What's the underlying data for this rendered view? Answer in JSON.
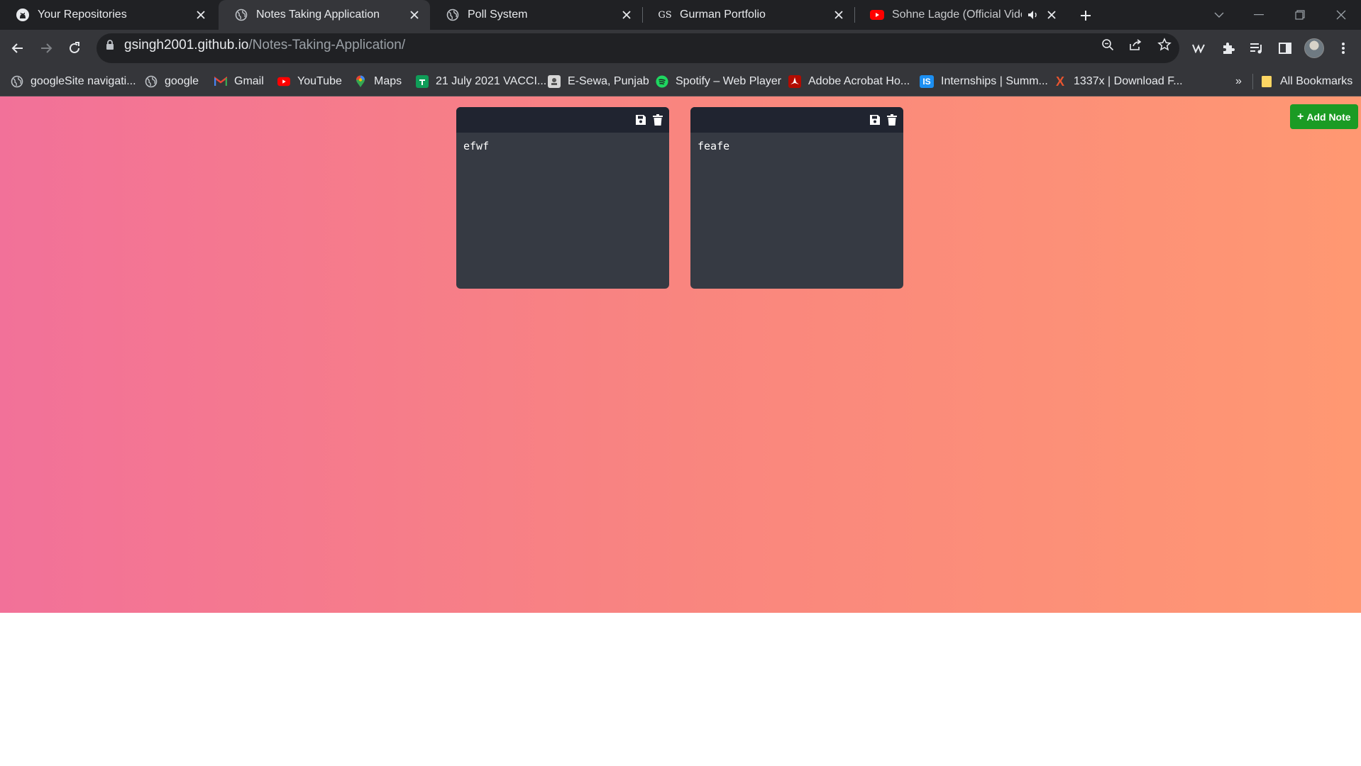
{
  "browser": {
    "tabs": [
      {
        "title": "Your Repositories",
        "icon": "github-icon",
        "active": false
      },
      {
        "title": "Notes Taking Application",
        "icon": "globe-icon",
        "active": true
      },
      {
        "title": "Poll System",
        "icon": "globe-icon",
        "active": false
      },
      {
        "title": "Gurman Portfolio",
        "icon": "gs-icon",
        "favicon_text": "GS",
        "active": false
      },
      {
        "title": "Sohne Lagde (Official Video",
        "icon": "youtube-icon",
        "active": false,
        "audio": true
      }
    ],
    "address": {
      "host": "gsingh2001.github.io",
      "path": "/Notes-Taking-Application/"
    },
    "bookmarks": [
      {
        "label": "googleSite navigati...",
        "icon": "globe-icon"
      },
      {
        "label": "google",
        "icon": "globe-icon"
      },
      {
        "label": "Gmail",
        "icon": "gmail-icon"
      },
      {
        "label": "YouTube",
        "icon": "youtube-icon"
      },
      {
        "label": "Maps",
        "icon": "maps-icon"
      },
      {
        "label": "21 July 2021 VACCI...",
        "icon": "sheets-icon"
      },
      {
        "label": "E-Sewa, Punjab",
        "icon": "emblem-icon"
      },
      {
        "label": "Spotify – Web Player",
        "icon": "spotify-icon"
      },
      {
        "label": "Adobe Acrobat Ho...",
        "icon": "acrobat-icon"
      },
      {
        "label": "Internships | Summ...",
        "icon": "is-icon",
        "favicon_text": "IS"
      },
      {
        "label": "1337x | Download F...",
        "icon": "x-icon",
        "favicon_text": "X"
      }
    ],
    "bookmarks_overflow": "»",
    "all_bookmarks": "All Bookmarks"
  },
  "app": {
    "add_note_label": "Add Note",
    "add_note_symbol": "+",
    "notes": [
      {
        "text": "efwf"
      },
      {
        "text": "feafe"
      }
    ],
    "colors": {
      "gradient_start": "#f27199",
      "gradient_end": "#ff9872",
      "note_body": "#363a43",
      "note_header": "#202430",
      "add_button": "#1a9b24"
    }
  }
}
